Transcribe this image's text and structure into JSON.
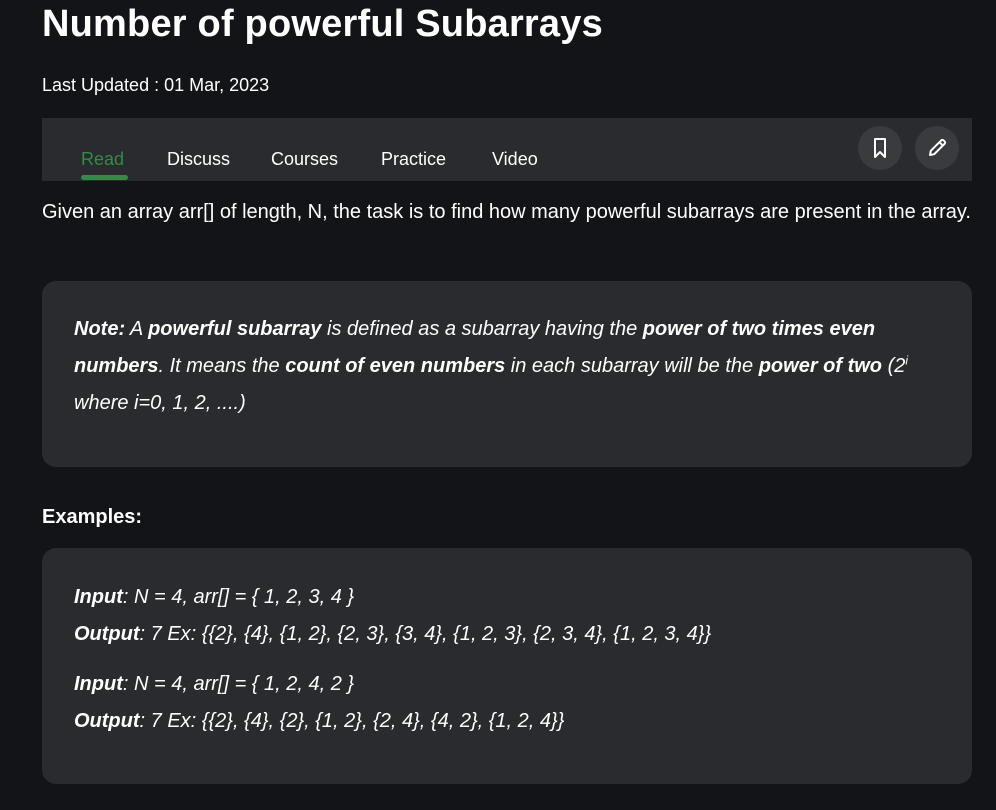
{
  "article": {
    "title": "Number of powerful Subarrays",
    "last_updated": "Last Updated : 01 Mar, 2023"
  },
  "tabs": {
    "items": [
      {
        "label": "Read",
        "active": true
      },
      {
        "label": "Discuss",
        "active": false
      },
      {
        "label": "Courses",
        "active": false
      },
      {
        "label": "Practice",
        "active": false
      },
      {
        "label": "Video",
        "active": false
      }
    ],
    "actions": [
      {
        "icon": "bookmark-icon"
      },
      {
        "icon": "pencil-icon"
      }
    ]
  },
  "intro": "Given an array arr[] of length, N, the task is to find how many powerful subarrays are present in the array.",
  "note": {
    "label": "Note:",
    "t1": " A ",
    "b1": "powerful subarray",
    "t2": " is defined as a subarray having the ",
    "b2": "power of two times even numbers",
    "t3": ". It means the ",
    "b3": "count of even numbers",
    "t4": " in each subarray will be the ",
    "b4": "power of two",
    "t5": " (2",
    "sup": "i",
    "t6": " where i=0, 1, 2, ....)"
  },
  "examples": {
    "label": "Examples:",
    "items": [
      {
        "input_label": "Input",
        "input": ": N = 4, arr[] = { 1, 2, 3, 4 }",
        "output_label": "Output",
        "output": ": 7 Ex: {{2}, {4}, {1, 2}, {2, 3}, {3, 4}, {1, 2, 3}, {2, 3, 4}, {1, 2, 3, 4}}"
      },
      {
        "input_label": "Input",
        "input": ": N = 4, arr[] = { 1, 2, 4, 2 }",
        "output_label": "Output",
        "output": ": 7 Ex: {{2}, {4}, {2}, {1, 2}, {2, 4}, {4, 2}, {1, 2, 4}}"
      }
    ]
  },
  "colors": {
    "background": "#131417",
    "panel": "#2a2b2e",
    "accent": "#2f8d46",
    "text": "#ffffff"
  }
}
